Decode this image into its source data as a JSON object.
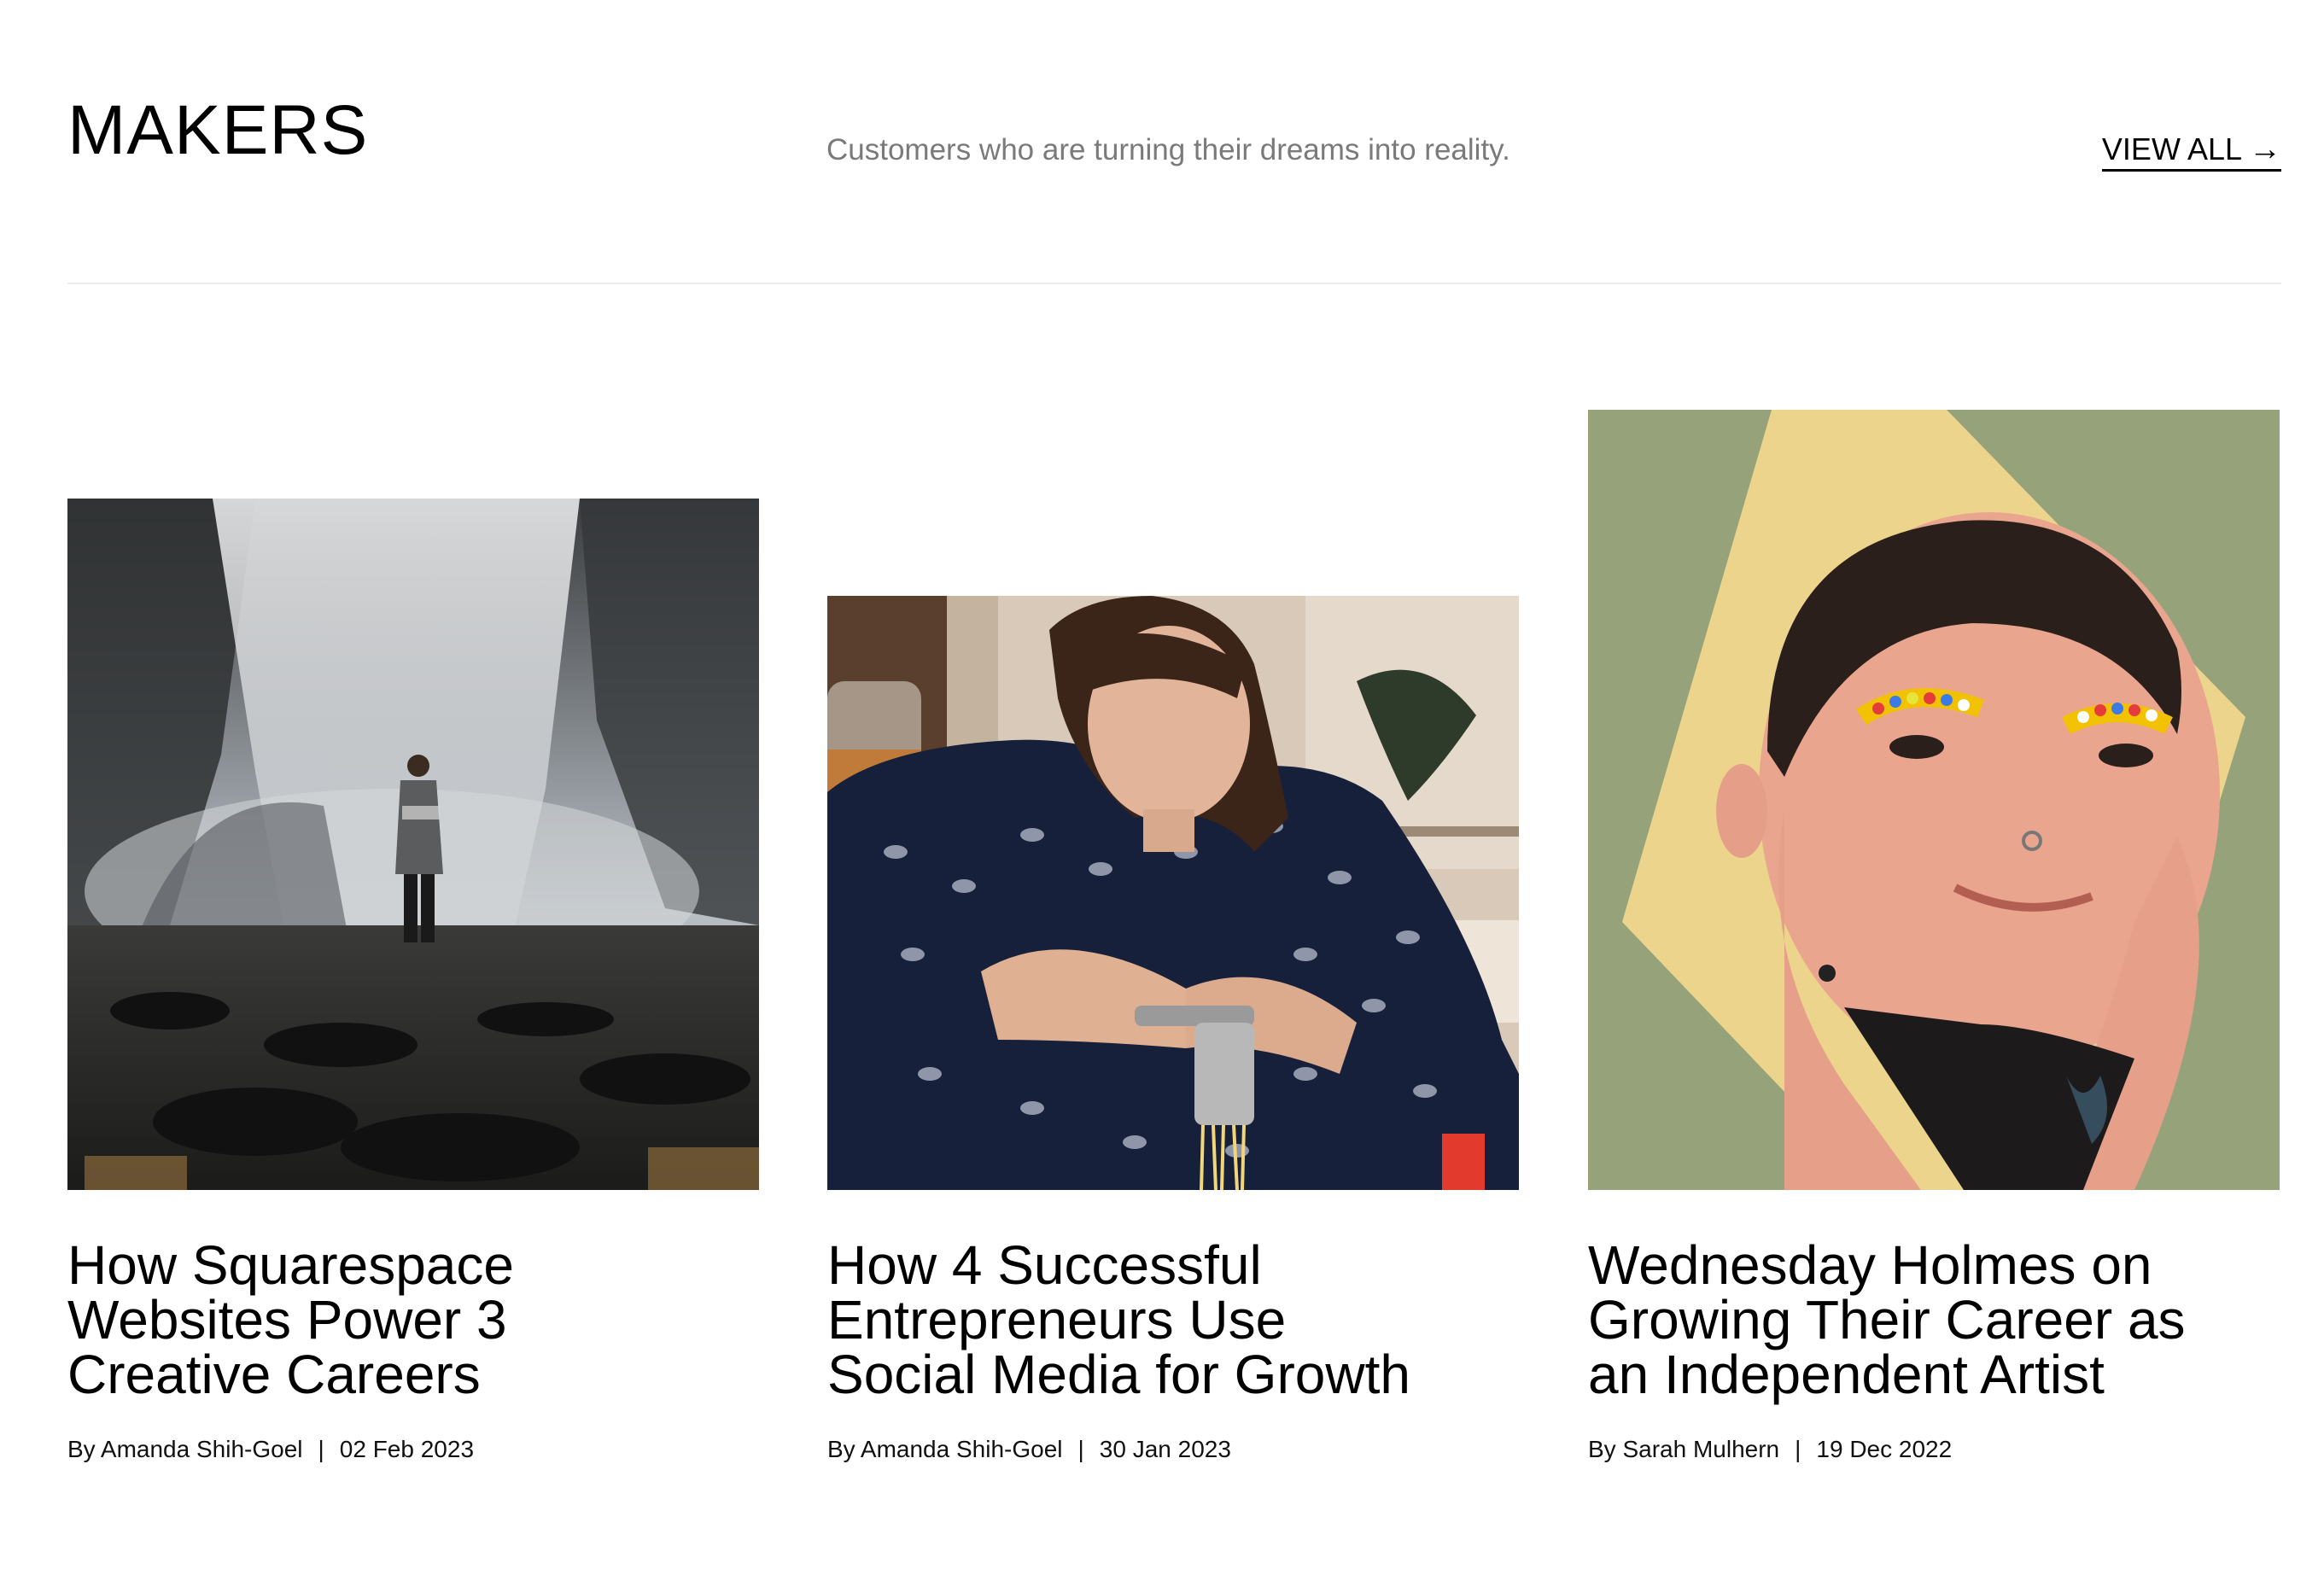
{
  "header": {
    "title": "MAKERS",
    "subtitle": "Customers who are turning their dreams into reality.",
    "view_all_label": "VIEW ALL",
    "view_all_icon": "arrow-right-icon"
  },
  "cards": [
    {
      "title_lines": [
        "How Squarespace",
        "Websites Power 3",
        "Creative Careers"
      ],
      "author": "By Amanda Shih-Goel",
      "separator": "|",
      "date": "02 Feb 2023"
    },
    {
      "title_lines": [
        "How 4 Successful",
        "Entrepreneurs Use",
        "Social Media for Growth"
      ],
      "author": "By Amanda Shih-Goel",
      "separator": "|",
      "date": "30 Jan 2023"
    },
    {
      "title_lines": [
        "Wednesday Holmes on",
        "Growing Their Career as",
        "an Independent Artist"
      ],
      "author": "By Sarah Mulhern",
      "separator": "|",
      "date": "19 Dec 2022"
    }
  ],
  "colors": {
    "subtitle_gray": "#7a7a7a",
    "divider": "#ececec",
    "artist_bg_green": "#96a37a",
    "artist_bg_yellow": "#e9cf86"
  }
}
